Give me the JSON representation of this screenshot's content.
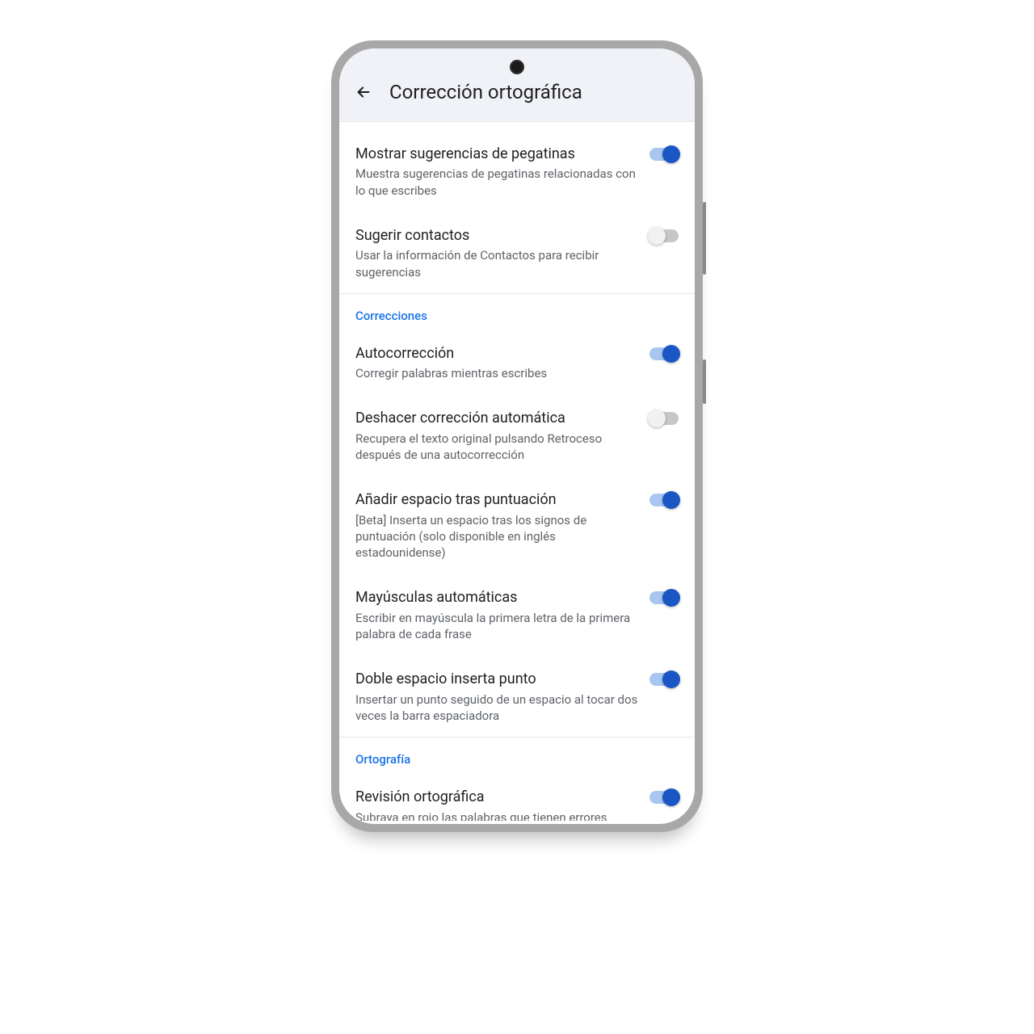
{
  "header": {
    "title": "Corrección ortográfica"
  },
  "groups": [
    {
      "header": null,
      "items": [
        {
          "title": "Mostrar sugerencias de pegatinas",
          "desc": "Muestra sugerencias de pegatinas relacionadas con lo que escribes",
          "on": true
        },
        {
          "title": "Sugerir contactos",
          "desc": "Usar la información de Contactos para recibir sugerencias",
          "on": false
        }
      ]
    },
    {
      "header": "Correcciones",
      "items": [
        {
          "title": "Autocorrección",
          "desc": "Corregir palabras mientras escribes",
          "on": true
        },
        {
          "title": "Deshacer corrección automática",
          "desc": "Recupera el texto original pulsando Retroceso después de una autocorrección",
          "on": false
        },
        {
          "title": "Añadir espacio tras puntuación",
          "desc": "[Beta] Inserta un espacio tras los signos de puntuación (solo disponible en inglés estadounidense)",
          "on": true
        },
        {
          "title": "Mayúsculas automáticas",
          "desc": "Escribir en mayúscula la primera letra de la primera palabra de cada frase",
          "on": true
        },
        {
          "title": "Doble espacio inserta punto",
          "desc": "Insertar un punto seguido de un espacio al tocar dos veces la barra espaciadora",
          "on": true
        }
      ]
    },
    {
      "header": "Ortografía",
      "items": [
        {
          "title": "Revisión ortográfica",
          "desc": "Subraya en rojo las palabras que tienen errores ortográficos mientras escribes",
          "on": true
        }
      ]
    }
  ]
}
